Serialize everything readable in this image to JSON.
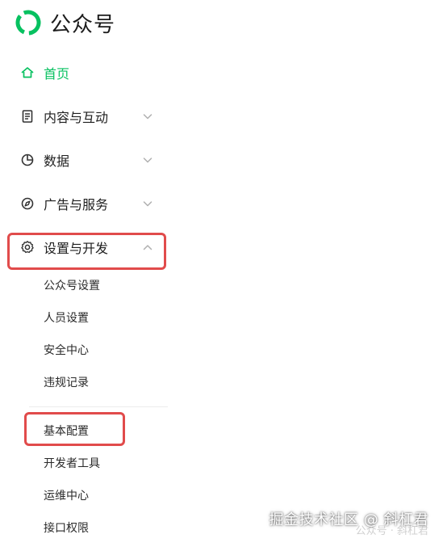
{
  "brand": {
    "title": "公众号",
    "accent_color": "#07c160"
  },
  "nav": {
    "home": {
      "label": "首页",
      "icon": "home-icon",
      "active": true
    },
    "content": {
      "label": "内容与互动",
      "icon": "document-icon",
      "chevron": "chevron-down-icon"
    },
    "data": {
      "label": "数据",
      "icon": "pie-chart-icon",
      "chevron": "chevron-down-icon"
    },
    "ads": {
      "label": "广告与服务",
      "icon": "compass-icon",
      "chevron": "chevron-down-icon"
    },
    "settings": {
      "label": "设置与开发",
      "icon": "gear-icon",
      "chevron": "chevron-up-icon",
      "items": [
        {
          "label": "公众号设置"
        },
        {
          "label": "人员设置"
        },
        {
          "label": "安全中心"
        },
        {
          "label": "违规记录"
        }
      ],
      "dev_items": [
        {
          "label": "基本配置"
        },
        {
          "label": "开发者工具"
        },
        {
          "label": "运维中心"
        },
        {
          "label": "接口权限"
        }
      ]
    }
  },
  "annotations": {
    "highlight_color": "#e14b4b"
  },
  "watermark": {
    "text": "掘金技术社区 @ 斜杠君",
    "faint_text": "公众号 · 斜杠君"
  }
}
